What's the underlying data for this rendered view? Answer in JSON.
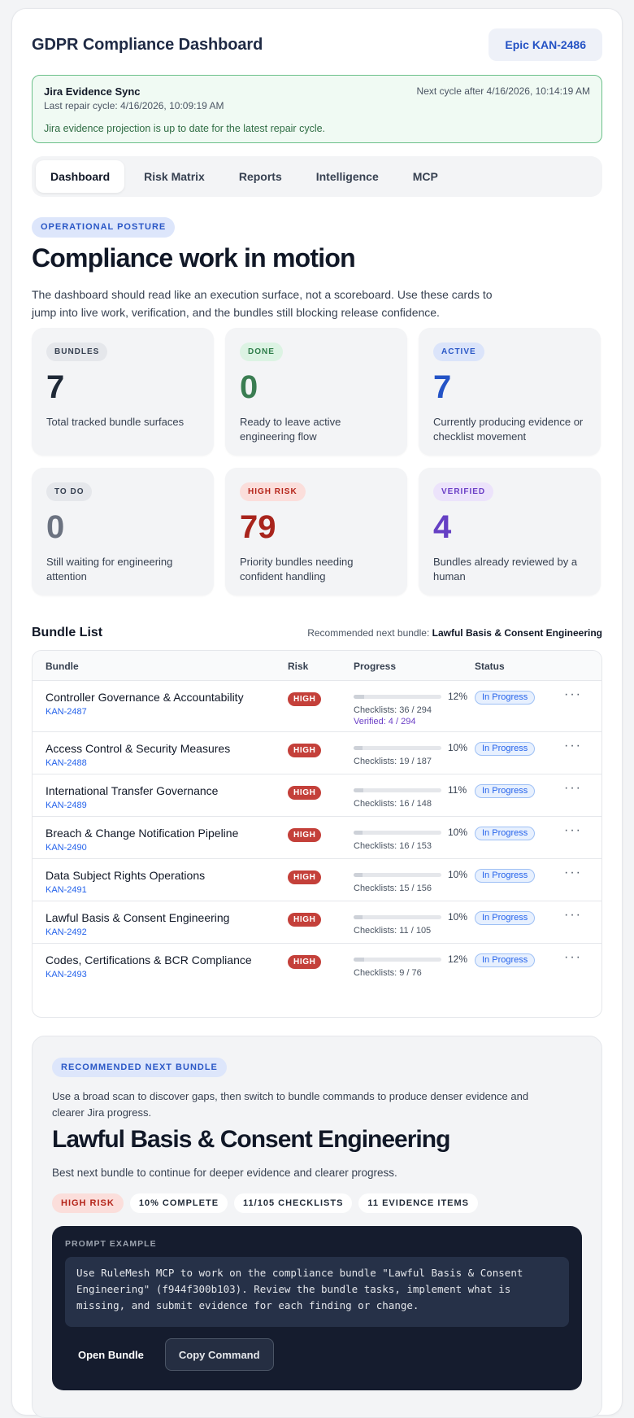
{
  "header": {
    "title": "GDPR Compliance Dashboard",
    "epic_button": "Epic KAN-2486"
  },
  "sync": {
    "title": "Jira Evidence Sync",
    "last_cycle": "Last repair cycle: 4/16/2026, 10:09:19 AM",
    "next_cycle": "Next cycle after 4/16/2026, 10:14:19 AM",
    "message": "Jira evidence projection is up to date for the latest repair cycle."
  },
  "tabs": [
    {
      "label": "Dashboard",
      "active": true
    },
    {
      "label": "Risk Matrix"
    },
    {
      "label": "Reports"
    },
    {
      "label": "Intelligence"
    },
    {
      "label": "MCP"
    }
  ],
  "hero": {
    "eyebrow": "OPERATIONAL POSTURE",
    "title": "Compliance work in motion",
    "description": "The dashboard should read like an execution surface, not a scoreboard. Use these cards to jump into live work, verification, and the bundles still blocking release confidence."
  },
  "stats": [
    {
      "badge": "BUNDLES",
      "value": "7",
      "desc": "Total tracked bundle surfaces",
      "color": "#1f2937"
    },
    {
      "badge": "DONE",
      "value": "0",
      "desc": "Ready to leave active engineering flow",
      "color": "#3a7d52"
    },
    {
      "badge": "ACTIVE",
      "value": "7",
      "desc": "Currently producing evidence or checklist movement",
      "color": "#2453c6"
    },
    {
      "badge": "TO DO",
      "value": "0",
      "desc": "Still waiting for engineering attention",
      "color": "#6b7280"
    },
    {
      "badge": "HIGH RISK",
      "value": "79",
      "desc": "Priority bundles needing confident handling",
      "color": "#a8241c"
    },
    {
      "badge": "VERIFIED",
      "value": "4",
      "desc": "Bundles already reviewed by a human",
      "color": "#6540c4"
    }
  ],
  "bundle_list": {
    "title": "Bundle List",
    "recommended_prefix": "Recommended next bundle:",
    "recommended_name": "Lawful Basis & Consent Engineering",
    "columns": [
      "Bundle",
      "Risk",
      "Progress",
      "Status"
    ],
    "rows": [
      {
        "name": "Controller Governance & Accountability",
        "key": "KAN-2487",
        "risk": "HIGH",
        "progress": 12,
        "pct": "12%",
        "checklists": "Checklists: 36 / 294",
        "verified": "Verified: 4 / 294",
        "status": "In Progress"
      },
      {
        "name": "Access Control & Security Measures",
        "key": "KAN-2488",
        "risk": "HIGH",
        "progress": 10,
        "pct": "10%",
        "checklists": "Checklists: 19 / 187",
        "status": "In Progress"
      },
      {
        "name": "International Transfer Governance",
        "key": "KAN-2489",
        "risk": "HIGH",
        "progress": 11,
        "pct": "11%",
        "checklists": "Checklists: 16 / 148",
        "status": "In Progress"
      },
      {
        "name": "Breach & Change Notification Pipeline",
        "key": "KAN-2490",
        "risk": "HIGH",
        "progress": 10,
        "pct": "10%",
        "checklists": "Checklists: 16 / 153",
        "status": "In Progress"
      },
      {
        "name": "Data Subject Rights Operations",
        "key": "KAN-2491",
        "risk": "HIGH",
        "progress": 10,
        "pct": "10%",
        "checklists": "Checklists: 15 / 156",
        "status": "In Progress"
      },
      {
        "name": "Lawful Basis & Consent Engineering",
        "key": "KAN-2492",
        "risk": "HIGH",
        "progress": 10,
        "pct": "10%",
        "checklists": "Checklists: 11 / 105",
        "status": "In Progress"
      },
      {
        "name": "Codes, Certifications & BCR Compliance",
        "key": "KAN-2493",
        "risk": "HIGH",
        "progress": 12,
        "pct": "12%",
        "checklists": "Checklists: 9 / 76",
        "status": "In Progress"
      }
    ],
    "more_glyph": "···"
  },
  "recommended": {
    "eyebrow": "RECOMMENDED NEXT BUNDLE",
    "intro": "Use a broad scan to discover gaps, then switch to bundle commands to produce denser evidence and clearer Jira progress.",
    "title": "Lawful Basis & Consent Engineering",
    "subtitle": "Best next bundle to continue for deeper evidence and clearer progress.",
    "chips": [
      "HIGH RISK",
      "10% COMPLETE",
      "11/105 CHECKLISTS",
      "11 EVIDENCE ITEMS"
    ],
    "prompt_label": "PROMPT EXAMPLE",
    "prompt_text": "Use RuleMesh MCP to work on the compliance bundle \"Lawful Basis & Consent Engineering\" (f944f300b103). Review the bundle tasks, implement what is missing, and submit evidence for each finding or change.",
    "open_button": "Open Bundle",
    "copy_button": "Copy Command"
  }
}
